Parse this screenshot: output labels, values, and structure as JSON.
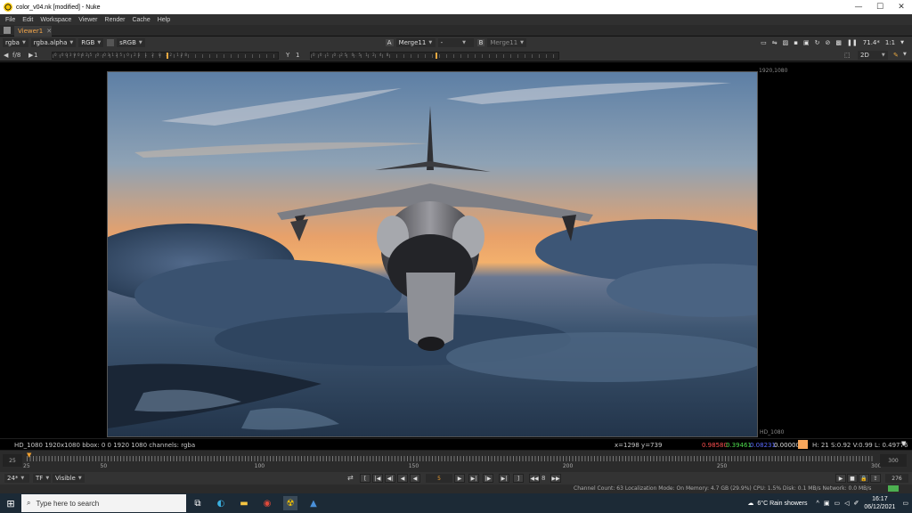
{
  "window": {
    "title": "color_v04.nk [modified] - Nuke",
    "min_glyph": "—",
    "max_glyph": "☐",
    "close_glyph": "✕"
  },
  "menu": [
    "File",
    "Edit",
    "Workspace",
    "Viewer",
    "Render",
    "Cache",
    "Help"
  ],
  "tab": {
    "label": "Viewer1",
    "close_glyph": "✕"
  },
  "viewer_toolbar": {
    "channels": "rgba",
    "alpha": "rgba.alpha",
    "display_channels": "RGB",
    "colorspace": "sRGB",
    "a_label": "A",
    "a_input": "Merge11",
    "op": "-",
    "b_label": "B",
    "b_input": "Merge11",
    "zoom": "71.4*",
    "ratio": "1:1"
  },
  "viewer_toolbar2": {
    "fstop": "f/8",
    "gain_value": "1",
    "gamma_label": "Y",
    "gamma_value": "1",
    "gain_ticks": "0.00390625 0.03125 0.25 1 2 8 32 128",
    "gamma_ticks": "0 0.1 0.25 0.5 1 2 4 8",
    "view_mode": "2D"
  },
  "viewer": {
    "format_top_right": "1920,1080",
    "format_bottom_right": "HD_1080"
  },
  "infobar": {
    "format": "HD_1080 1920x1080  bbox: 0 0 1920 1080 channels: rgba",
    "coords": "x=1298 y=739",
    "r": "0.98580",
    "g": "0.39461",
    "b": "0.08231",
    "a": "0.00000",
    "hsvl": "H: 21 S:0.92 V:0.99  L: 0.49776",
    "swatch_color": "#f8a75c"
  },
  "timeline": {
    "in_frame": "25",
    "current_frame": "25",
    "out_frame": "300",
    "labels": [
      "25",
      "50",
      "100",
      "150",
      "200",
      "250",
      "300"
    ],
    "start": 25,
    "end": 300
  },
  "transport": {
    "fps": "24*",
    "tf": "TF",
    "range": "Visible",
    "frame": "5",
    "increment": "8",
    "end_frame": "276"
  },
  "status": "Channel Count: 63  Localization Mode: On  Memory: 4.7 GB (29.9%)  CPU: 1.5%  Disk: 0.1 MB/s  Network: 0.0 MB/s",
  "taskbar": {
    "search_placeholder": "Type here to search",
    "weather": "6°C  Rain showers",
    "time": "16:17",
    "date": "06/12/2021"
  }
}
